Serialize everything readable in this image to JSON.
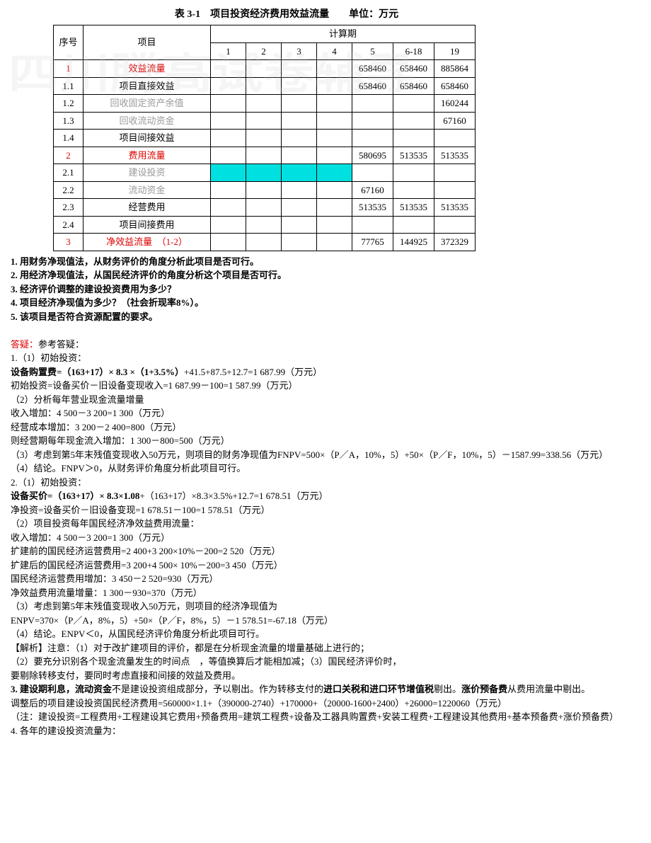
{
  "table": {
    "title": "表 3-1　项目投资经济费用效益流量　　单位：万元",
    "header": {
      "seq": "序号",
      "item": "项目",
      "calc_period": "计算期",
      "periods": [
        "1",
        "2",
        "3",
        "4",
        "5",
        "6-18",
        "19"
      ]
    },
    "rows": [
      {
        "seq": "1",
        "item": "效益流量",
        "red": true,
        "cells": [
          "",
          "",
          "",
          "",
          "658460",
          "658460",
          "885864"
        ]
      },
      {
        "seq": "1.1",
        "item": "项目直接效益",
        "cells": [
          "",
          "",
          "",
          "",
          "658460",
          "658460",
          "658460"
        ]
      },
      {
        "seq": "1.2",
        "item": "回收固定资产余值",
        "grey": true,
        "cells": [
          "",
          "",
          "",
          "",
          "",
          "",
          "160244"
        ]
      },
      {
        "seq": "1.3",
        "item": "回收流动资金",
        "grey": true,
        "cells": [
          "",
          "",
          "",
          "",
          "",
          "",
          "67160"
        ]
      },
      {
        "seq": "1.4",
        "item": "项目间接效益",
        "cells": [
          "",
          "",
          "",
          "",
          "",
          "",
          ""
        ]
      },
      {
        "seq": "2",
        "item": "费用流量",
        "red": true,
        "cells": [
          "",
          "",
          "",
          "",
          "580695",
          "513535",
          "513535"
        ]
      },
      {
        "seq": "2.1",
        "item": "建设投资",
        "grey": true,
        "cyan": true,
        "cells": [
          "",
          "",
          "",
          "",
          "",
          "",
          ""
        ]
      },
      {
        "seq": "2.2",
        "item": "流动资金",
        "grey": true,
        "cells": [
          "",
          "",
          "",
          "",
          "67160",
          "",
          ""
        ]
      },
      {
        "seq": "2.3",
        "item": "经营费用",
        "cells": [
          "",
          "",
          "",
          "",
          "513535",
          "513535",
          "513535"
        ]
      },
      {
        "seq": "2.4",
        "item": "项目间接费用",
        "cells": [
          "",
          "",
          "",
          "",
          "",
          "",
          ""
        ]
      },
      {
        "seq": "3",
        "item": "净效益流量　（1-2）",
        "red": true,
        "cells": [
          "",
          "",
          "",
          "",
          "77765",
          "144925",
          "372329"
        ]
      }
    ]
  },
  "questions": [
    "1. 用财务净现值法，从财务评价的角度分析此项目是否可行。",
    "2. 用经济净现值法，从国民经济评价的角度分析这个项目是否可行。",
    "3. 经济评价调整的建设投资费用为多少？",
    "4. 项目经济净现值为多少？（社会折现率8%）。",
    "5. 该项目是否符合资源配置的要求。"
  ],
  "answer_heading": "答疑：",
  "answer_ref": "参考答疑：",
  "lines": {
    "l1": "1.（1）初始投资：",
    "l2a": "设备购置费=（163+17）× 8.3 ×（1+3.5%）",
    "l2b": "+41.5+87.5+12.7=1 687.99（万元）",
    "l3": "初始投资=设备买价－旧设备变现收入=1 687.99－100=1 587.99（万元）",
    "l4": "（2）分析每年营业现金流量增量",
    "l5": "收入增加：4 500－3 200=1 300（万元）",
    "l6": "经营成本增加：3 200－2 400=800（万元）",
    "l7": "则经营期每年现金流入增加：1 300－800=500（万元）",
    "l8": "（3）考虑到第5年末残值变现收入50万元，则项目的财务净现值为FNPV=500×（P／A，10%，5）+50×（P／F，10%，5）－1587.99=338.56（万元）",
    "l9": "（4）结论。FNPV＞0，从财务评价角度分析此项目可行。",
    "l10": "2.（1）初始投资：",
    "l11a": "设备买价=（163+17）× 8.3×1.08",
    "l11b": "+（163+17）×8.3×3.5%+12.7=1 678.51（万元）",
    "l12": "净投资=设备买价－旧设备变现=1 678.51－100=1 578.51（万元）",
    "l13": "（2）项目投资每年国民经济净效益费用流量：",
    "l14": "收入增加：4 500－3 200=1 300（万元）",
    "l15": "扩建前的国民经济运营费用=2 400+3 200×10%－200=2 520（万元）",
    "l16": "扩建后的国民经济运营费用=3 200+4 500× 10%－200=3 450（万元）",
    "l17": "国民经济运营费用增加：3 450－2 520=930（万元）",
    "l18": "净效益费用流量增量：1 300－930=370（万元）",
    "l19": "（3）考虑到第5年末残值变现收入50万元，则项目的经济净现值为",
    "l20": "ENPV=370×（P／A，8%，5）+50×（P／F，8%，5）－1 578.51=-67.18（万元）",
    "l21": "（4）结论。ENPV＜0，从国民经济评价角度分析此项目可行。",
    "l22": "【解析】注意：（1）对于改扩建项目的评价，都是在分析现金流量的增量基础上进行的；",
    "l23": "（2）要充分识别各个现金流量发生的时间点　，等值换算后才能相加减；（3）国民经济评价时，",
    "l24": "要剔除转移支付，要同时考虑直接和间接的效益及费用。",
    "l25a": "3. 建设期利息，流动资金",
    "l25b": "不是建设投资组成部分，予以剔出。作为转移支付的",
    "l25c": "进口关税和进口环节增值税",
    "l25d": "剔出。",
    "l25e": "涨价预备费",
    "l25f": "从费用流量中剔出。",
    "l26": "调整后的项目建设投资国民经济费用=560000×1.1+（390000-2740）+170000+（20000-1600+2400）+26000=1220060（万元）",
    "l27": "（注：建设投资=工程费用+工程建设其它费用+预备费用=建筑工程费+设备及工器具购置费+安装工程费+工程建设其他费用+基本预备费+涨价预备费）",
    "l28": "4. 各年的建设投资流量为："
  }
}
